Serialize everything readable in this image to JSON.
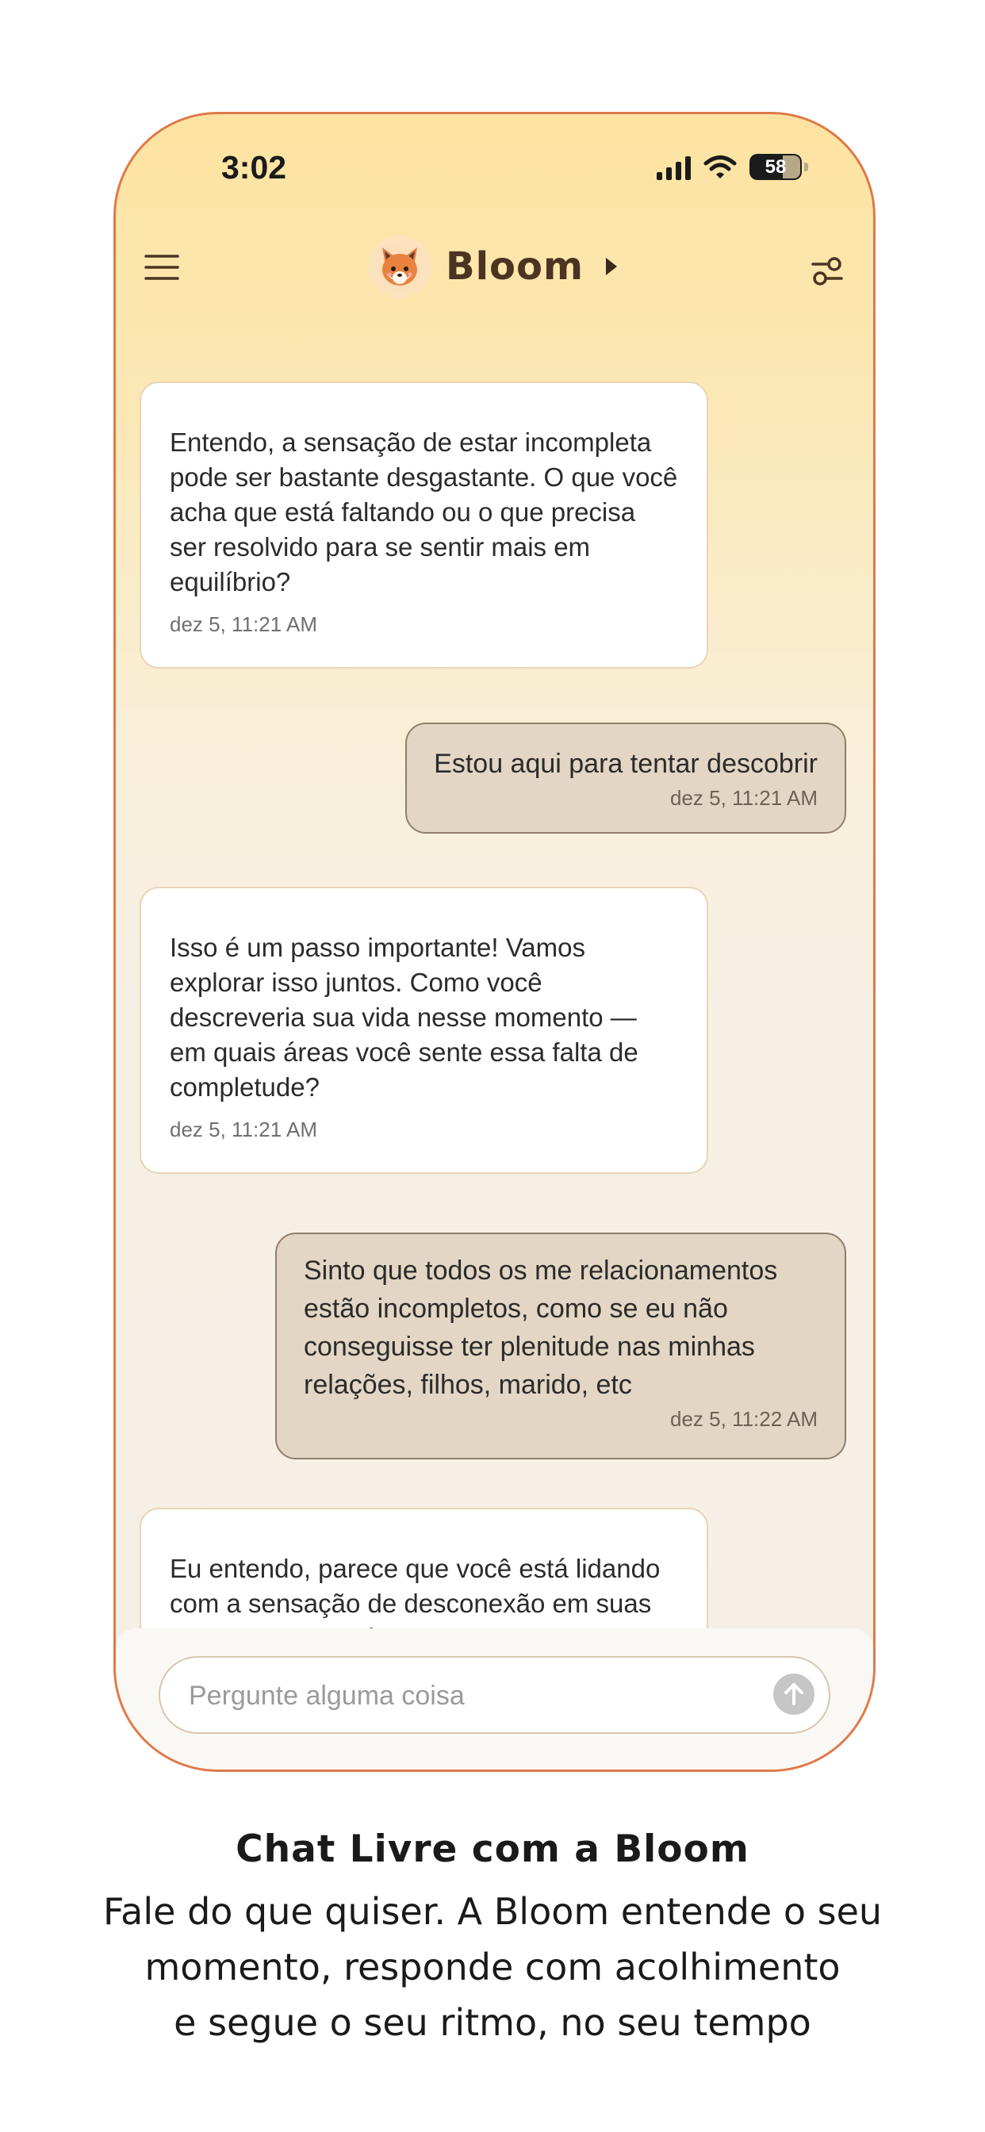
{
  "status_bar": {
    "time": "3:02",
    "battery": "58"
  },
  "header": {
    "app_name": "Bloom",
    "menu_icon": "hamburger-menu-icon",
    "settings_icon": "sliders-settings-icon",
    "avatar_icon": "fox-avatar-icon"
  },
  "messages": [
    {
      "sender": "bot",
      "text": "Entendo, a sensação de estar incompleta pode ser bastante desgastante. O que você acha que está faltando ou o que precisa ser resolvido para se sentir mais em equilíbrio?",
      "time": "dez 5, 11:21 AM"
    },
    {
      "sender": "user",
      "text": "Estou aqui para tentar descobrir",
      "time": "dez 5, 11:21 AM"
    },
    {
      "sender": "bot",
      "text": "Isso é um passo importante! Vamos explorar isso juntos. Como você descreveria sua vida nesse momento — em quais áreas você sente essa falta de completude?",
      "time": "dez 5, 11:21 AM"
    },
    {
      "sender": "user",
      "text": "Sinto que todos os me relacionamentos estão incompletos, como se eu não conseguisse ter plenitude nas minhas relações, filhos, marido, etc",
      "time": "dez 5, 11:22 AM"
    },
    {
      "sender": "bot",
      "text": "Eu entendo, parece que você está lidando com a sensação de desconexão em suas relações mais próximas. Isso",
      "time": ""
    }
  ],
  "composer": {
    "placeholder": "Pergunte alguma coisa",
    "value": "",
    "send_icon": "arrow-up-icon"
  },
  "caption": {
    "title": "Chat Livre com a Bloom",
    "line1": "Fale do que quiser. A Bloom entende o seu",
    "line2": "momento, responde com acolhimento",
    "line3": "e segue o seu ritmo, no seu tempo"
  },
  "colors": {
    "frame_border": "#de7a4a",
    "user_bubble": "#e3d6c4",
    "bot_bubble": "#ffffff",
    "brand_text": "#4b3422"
  }
}
